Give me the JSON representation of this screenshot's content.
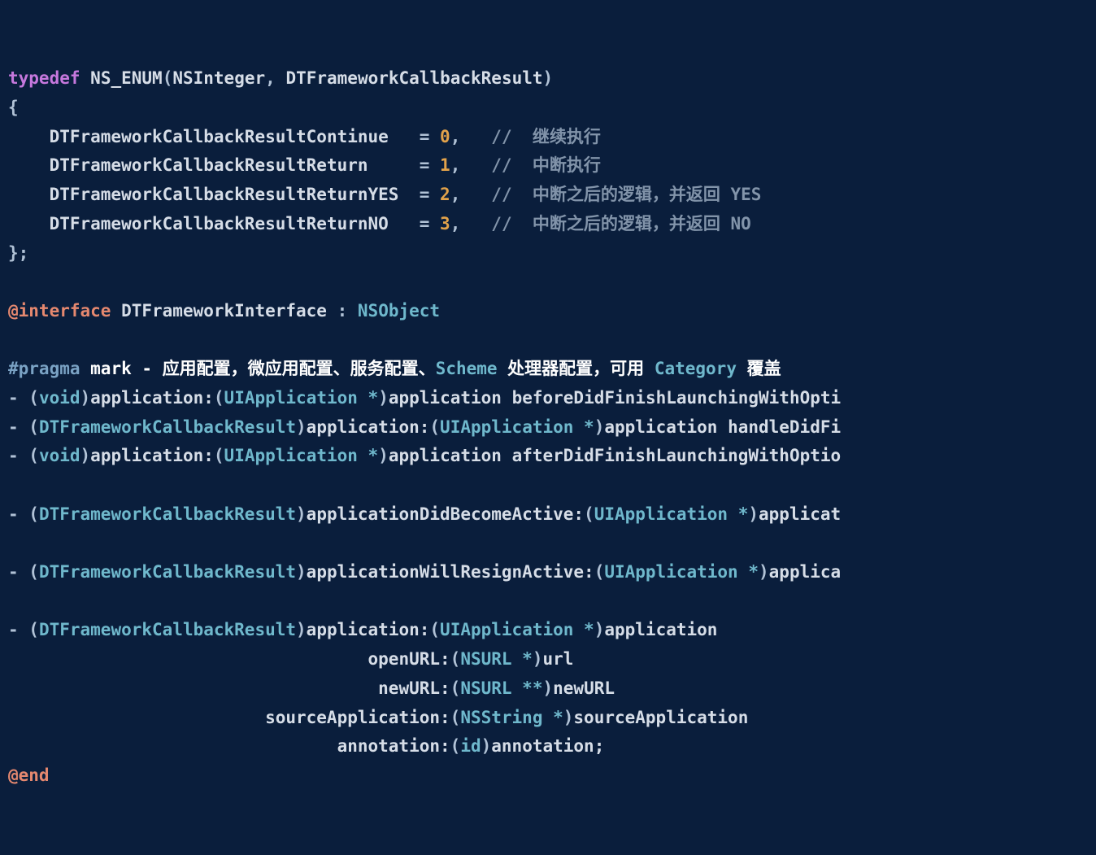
{
  "typedef_kw": "typedef",
  "nsenum": "NS_ENUM",
  "nsinteger": "NSInteger",
  "enumname": "DTFrameworkCallbackResult",
  "openbrace": "{",
  "closebrace": "};",
  "enum0_name": "DTFrameworkCallbackResultContinue",
  "enum0_eq": "= ",
  "enum0_val": "0",
  "enum0_comma": ",",
  "enum0_cmt": "//  继续执行",
  "enum1_name": "DTFrameworkCallbackResultReturn",
  "enum1_eq": "= ",
  "enum1_val": "1",
  "enum1_comma": ",",
  "enum1_cmt": "//  中断执行",
  "enum2_name": "DTFrameworkCallbackResultReturnYES",
  "enum2_eq": "= ",
  "enum2_val": "2",
  "enum2_comma": ",",
  "enum2_cmt": "//  中断之后的逻辑，并返回 YES",
  "enum3_name": "DTFrameworkCallbackResultReturnNO",
  "enum3_eq": "= ",
  "enum3_val": "3",
  "enum3_comma": ",",
  "enum3_cmt": "//  中断之后的逻辑，并返回 NO",
  "at_interface": "@interface",
  "ifacename": "DTFrameworkInterface",
  "colon_sp": " : ",
  "nsobject": "NSObject",
  "pragma_kw": "#pragma",
  "pragma_mark": " mark - 应用配置，微应用配置、服务配置、",
  "pragma_scheme": "Scheme",
  "pragma_rest1": " 处理器配置，可用 ",
  "pragma_cat": "Category",
  "pragma_rest2": " 覆盖",
  "m1_dash": "- (",
  "m1_ret": "void",
  "m1_close": ")",
  "m1_sel1": "application:",
  "m1_p1o": "(",
  "m1_p1t": "UIApplication *",
  "m1_p1c": ")",
  "m1_p1n": "application ",
  "m1_sel2": "beforeDidFinishLaunchingWithOpti",
  "m2_dash": "- (",
  "m2_ret": "DTFrameworkCallbackResult",
  "m2_close": ")",
  "m2_sel1": "application:",
  "m2_p1o": "(",
  "m2_p1t": "UIApplication *",
  "m2_p1c": ")",
  "m2_p1n": "application ",
  "m2_sel2": "handleDidFi",
  "m3_dash": "- (",
  "m3_ret": "void",
  "m3_close": ")",
  "m3_sel1": "application:",
  "m3_p1o": "(",
  "m3_p1t": "UIApplication *",
  "m3_p1c": ")",
  "m3_p1n": "application ",
  "m3_sel2": "afterDidFinishLaunchingWithOptio",
  "m4_dash": "- (",
  "m4_ret": "DTFrameworkCallbackResult",
  "m4_close": ")",
  "m4_sel": "applicationDidBecomeActive:",
  "m4_po": "(",
  "m4_pt": "UIApplication *",
  "m4_pc": ")",
  "m4_pn": "applicat",
  "m5_dash": "- (",
  "m5_ret": "DTFrameworkCallbackResult",
  "m5_close": ")",
  "m5_sel": "applicationWillResignActive:",
  "m5_po": "(",
  "m5_pt": "UIApplication *",
  "m5_pc": ")",
  "m5_pn": "applica",
  "m6_dash": "- (",
  "m6_ret": "DTFrameworkCallbackResult",
  "m6_close": ")",
  "m6_s1": "application:",
  "m6_p1o": "(",
  "m6_p1t": "UIApplication *",
  "m6_p1c": ")",
  "m6_p1n": "application",
  "m6_indent1": "                                   ",
  "m6_s2": "openURL:",
  "m6_p2o": "(",
  "m6_p2t": "NSURL *",
  "m6_p2c": ")",
  "m6_p2n": "url",
  "m6_indent2": "                                    ",
  "m6_s3": "newURL:",
  "m6_p3o": "(",
  "m6_p3t": "NSURL **",
  "m6_p3c": ")",
  "m6_p3n": "newURL",
  "m6_indent3": "                         ",
  "m6_s4": "sourceApplication:",
  "m6_p4o": "(",
  "m6_p4t": "NSString *",
  "m6_p4c": ")",
  "m6_p4n": "sourceApplication",
  "m6_indent4": "                                ",
  "m6_s5": "annotation:",
  "m6_p5o": "(",
  "m6_p5t": "id",
  "m6_p5c": ")",
  "m6_p5n": "annotation;",
  "at_end": "@end"
}
